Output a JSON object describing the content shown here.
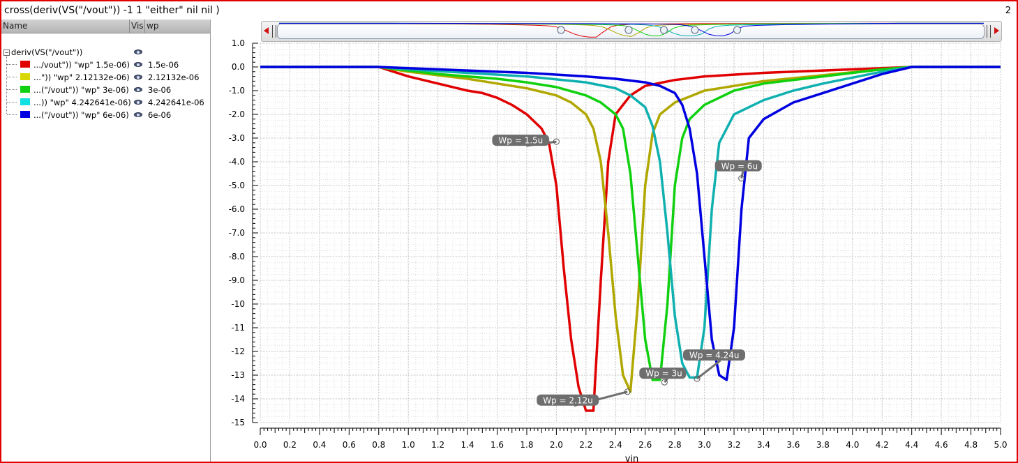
{
  "window": {
    "title": "cross(deriv(VS(\"/vout\")) -1 1 \"either\" nil nil )",
    "number": "2"
  },
  "legend": {
    "columns": {
      "name": "Name",
      "vis": "Vis",
      "wp": "wp"
    },
    "parent": {
      "label": "deriv(VS(\"/vout\"))",
      "icon": "eye-icon"
    },
    "rows": [
      {
        "name": ".../vout\")) \"wp\" 1.5e-06)",
        "wp": "1.5e-06",
        "color": "#e00000"
      },
      {
        "name": "...\")) \"wp\" 2.12132e-06)",
        "wp": "2.12132e-06",
        "color": "#d8d800"
      },
      {
        "name": "...(\"/vout\")) \"wp\" 3e-06)",
        "wp": "3e-06",
        "color": "#10d010"
      },
      {
        "name": "...)) \"wp\" 4.242641e-06)",
        "wp": "4.242641e-06",
        "color": "#10e0e0"
      },
      {
        "name": "...(\"/vout\")) \"wp\" 6e-06)",
        "wp": "6e-06",
        "color": "#0000e0"
      }
    ]
  },
  "chart_data": {
    "type": "line",
    "xlabel": "vin",
    "ylabel": "",
    "xlim": [
      0.0,
      5.0
    ],
    "ylim": [
      -15,
      1.0
    ],
    "grid": true,
    "x_ticks": [
      "0.0",
      "0.2",
      "0.4",
      "0.6",
      "0.8",
      "1.0",
      "1.2",
      "1.4",
      "1.6",
      "1.8",
      "2.0",
      "2.2",
      "2.4",
      "2.6",
      "2.8",
      "3.0",
      "3.2",
      "3.4",
      "3.6",
      "3.8",
      "4.0",
      "4.2",
      "4.4",
      "4.6",
      "4.8",
      "5.0"
    ],
    "y_ticks": [
      "1.0",
      "0.0",
      "-1.0",
      "-2.0",
      "-3.0",
      "-4.0",
      "-5.0",
      "-6.0",
      "-7.0",
      "-8.0",
      "-9.0",
      "-10",
      "-11",
      "-12",
      "-13",
      "-14",
      "-15"
    ],
    "series": [
      {
        "color": "#e00000",
        "x": [
          0.0,
          0.8,
          0.9,
          1.0,
          1.1,
          1.2,
          1.3,
          1.4,
          1.5,
          1.6,
          1.7,
          1.8,
          1.9,
          1.95,
          2.0,
          2.05,
          2.1,
          2.15,
          2.2,
          2.25,
          2.3,
          2.35,
          2.4,
          2.5,
          2.6,
          2.8,
          3.0,
          3.4,
          3.8,
          4.2,
          4.4,
          5.0
        ],
        "y": [
          0.0,
          0.0,
          -0.2,
          -0.4,
          -0.55,
          -0.7,
          -0.85,
          -1.0,
          -1.1,
          -1.3,
          -1.6,
          -2.0,
          -2.6,
          -3.2,
          -5.0,
          -8.5,
          -11.5,
          -13.5,
          -14.5,
          -14.5,
          -9.0,
          -4.0,
          -2.0,
          -1.2,
          -0.8,
          -0.55,
          -0.4,
          -0.25,
          -0.15,
          -0.05,
          0.0,
          0.0
        ]
      },
      {
        "color": "#b0a800",
        "x": [
          0.0,
          0.8,
          1.0,
          1.2,
          1.4,
          1.6,
          1.8,
          2.0,
          2.1,
          2.2,
          2.25,
          2.3,
          2.35,
          2.4,
          2.45,
          2.5,
          2.55,
          2.6,
          2.65,
          2.7,
          2.8,
          3.0,
          3.4,
          3.8,
          4.2,
          4.4,
          5.0
        ],
        "y": [
          0.0,
          0.0,
          -0.2,
          -0.35,
          -0.5,
          -0.7,
          -0.9,
          -1.2,
          -1.5,
          -2.0,
          -2.6,
          -4.0,
          -7.0,
          -10.5,
          -13.0,
          -13.7,
          -10.0,
          -5.0,
          -2.8,
          -2.0,
          -1.5,
          -1.0,
          -0.6,
          -0.35,
          -0.1,
          0.0,
          0.0
        ]
      },
      {
        "color": "#10d010",
        "x": [
          0.0,
          0.8,
          1.0,
          1.2,
          1.4,
          1.6,
          1.8,
          2.0,
          2.2,
          2.3,
          2.4,
          2.45,
          2.5,
          2.55,
          2.6,
          2.65,
          2.7,
          2.75,
          2.8,
          2.85,
          2.9,
          3.0,
          3.2,
          3.4,
          3.8,
          4.2,
          4.4,
          5.0
        ],
        "y": [
          0.0,
          0.0,
          -0.15,
          -0.3,
          -0.4,
          -0.5,
          -0.65,
          -0.85,
          -1.2,
          -1.5,
          -2.0,
          -2.6,
          -4.5,
          -8.0,
          -11.5,
          -13.2,
          -13.2,
          -10.0,
          -5.0,
          -3.0,
          -2.2,
          -1.6,
          -1.0,
          -0.7,
          -0.4,
          -0.1,
          0.0,
          0.0
        ]
      },
      {
        "color": "#10b0b0",
        "x": [
          0.0,
          0.8,
          1.0,
          1.4,
          1.8,
          2.2,
          2.4,
          2.5,
          2.6,
          2.65,
          2.7,
          2.75,
          2.8,
          2.85,
          2.9,
          2.95,
          3.0,
          3.05,
          3.1,
          3.2,
          3.4,
          3.6,
          3.8,
          4.0,
          4.2,
          4.4,
          5.0
        ],
        "y": [
          0.0,
          0.0,
          -0.1,
          -0.25,
          -0.4,
          -0.65,
          -0.9,
          -1.2,
          -1.7,
          -2.5,
          -4.0,
          -7.0,
          -10.5,
          -12.5,
          -13.1,
          -13.1,
          -11.0,
          -6.0,
          -3.2,
          -2.0,
          -1.4,
          -1.0,
          -0.7,
          -0.45,
          -0.2,
          0.0,
          0.0
        ]
      },
      {
        "color": "#0000e0",
        "x": [
          0.0,
          0.8,
          1.0,
          1.4,
          1.8,
          2.2,
          2.4,
          2.6,
          2.7,
          2.8,
          2.85,
          2.9,
          2.95,
          3.0,
          3.05,
          3.1,
          3.15,
          3.2,
          3.25,
          3.3,
          3.4,
          3.6,
          3.8,
          4.0,
          4.2,
          4.4,
          5.0
        ],
        "y": [
          0.0,
          0.0,
          -0.05,
          -0.15,
          -0.25,
          -0.4,
          -0.5,
          -0.65,
          -0.8,
          -1.1,
          -1.6,
          -2.6,
          -4.5,
          -8.0,
          -11.5,
          -13.0,
          -13.2,
          -11.0,
          -6.0,
          -3.0,
          -2.2,
          -1.5,
          -1.1,
          -0.7,
          -0.3,
          0.0,
          0.0
        ]
      }
    ],
    "annotations": [
      {
        "text": "Wp = 1.5u",
        "x": 2.0,
        "y": -3.15
      },
      {
        "text": "Wp = 2.12u",
        "x": 2.48,
        "y": -13.7
      },
      {
        "text": "Wp = 3u",
        "x": 2.73,
        "y": -13.3
      },
      {
        "text": "Wp = 4.24u",
        "x": 2.95,
        "y": -13.15
      },
      {
        "text": "Wp = 6u",
        "x": 3.25,
        "y": -4.7
      }
    ]
  }
}
